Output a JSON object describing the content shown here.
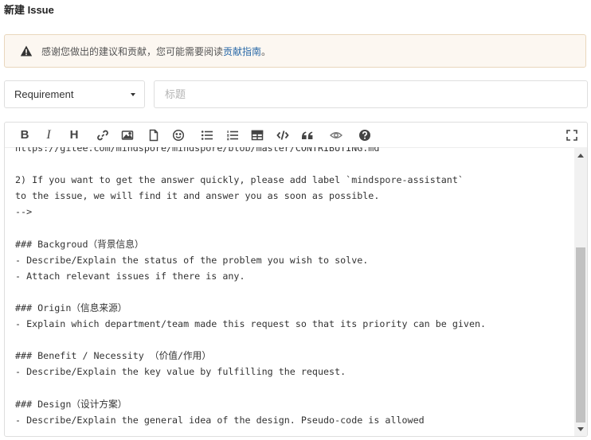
{
  "page": {
    "title": "新建 Issue"
  },
  "notice": {
    "text": "感谢您做出的建议和贡献，您可能需要阅读",
    "link": "贡献指南",
    "end": "。",
    "icon": "warning-icon"
  },
  "form": {
    "type_value": "Requirement",
    "title_placeholder": "标题"
  },
  "toolbar": {
    "bold": "B",
    "italic": "I",
    "heading": "H",
    "icons": [
      "link-icon",
      "image-icon",
      "file-icon",
      "emoji-icon",
      "bullet-list-icon",
      "numbered-list-icon",
      "table-icon",
      "code-icon",
      "quote-icon",
      "preview-icon",
      "help-icon",
      "fullscreen-icon"
    ]
  },
  "editor": {
    "lines": [
      "https://gitee.com/mindspore/mindspore/blob/master/CONTRIBUTING.md",
      "",
      "2) If you want to get the answer quickly, please add label `mindspore-assistant`",
      "to the issue, we will find it and answer you as soon as possible.",
      "-->",
      "",
      "### Backgroud（背景信息）",
      "- Describe/Explain the status of the problem you wish to solve.",
      "- Attach relevant issues if there is any.",
      "",
      "### Origin（信息来源）",
      "- Explain which department/team made this request so that its priority can be given.",
      "",
      "### Benefit / Necessity （价值/作用）",
      "- Describe/Explain the key value by fulfilling the request.",
      "",
      "### Design（设计方案）",
      "- Describe/Explain the general idea of the design. Pseudo-code is allowed"
    ]
  }
}
